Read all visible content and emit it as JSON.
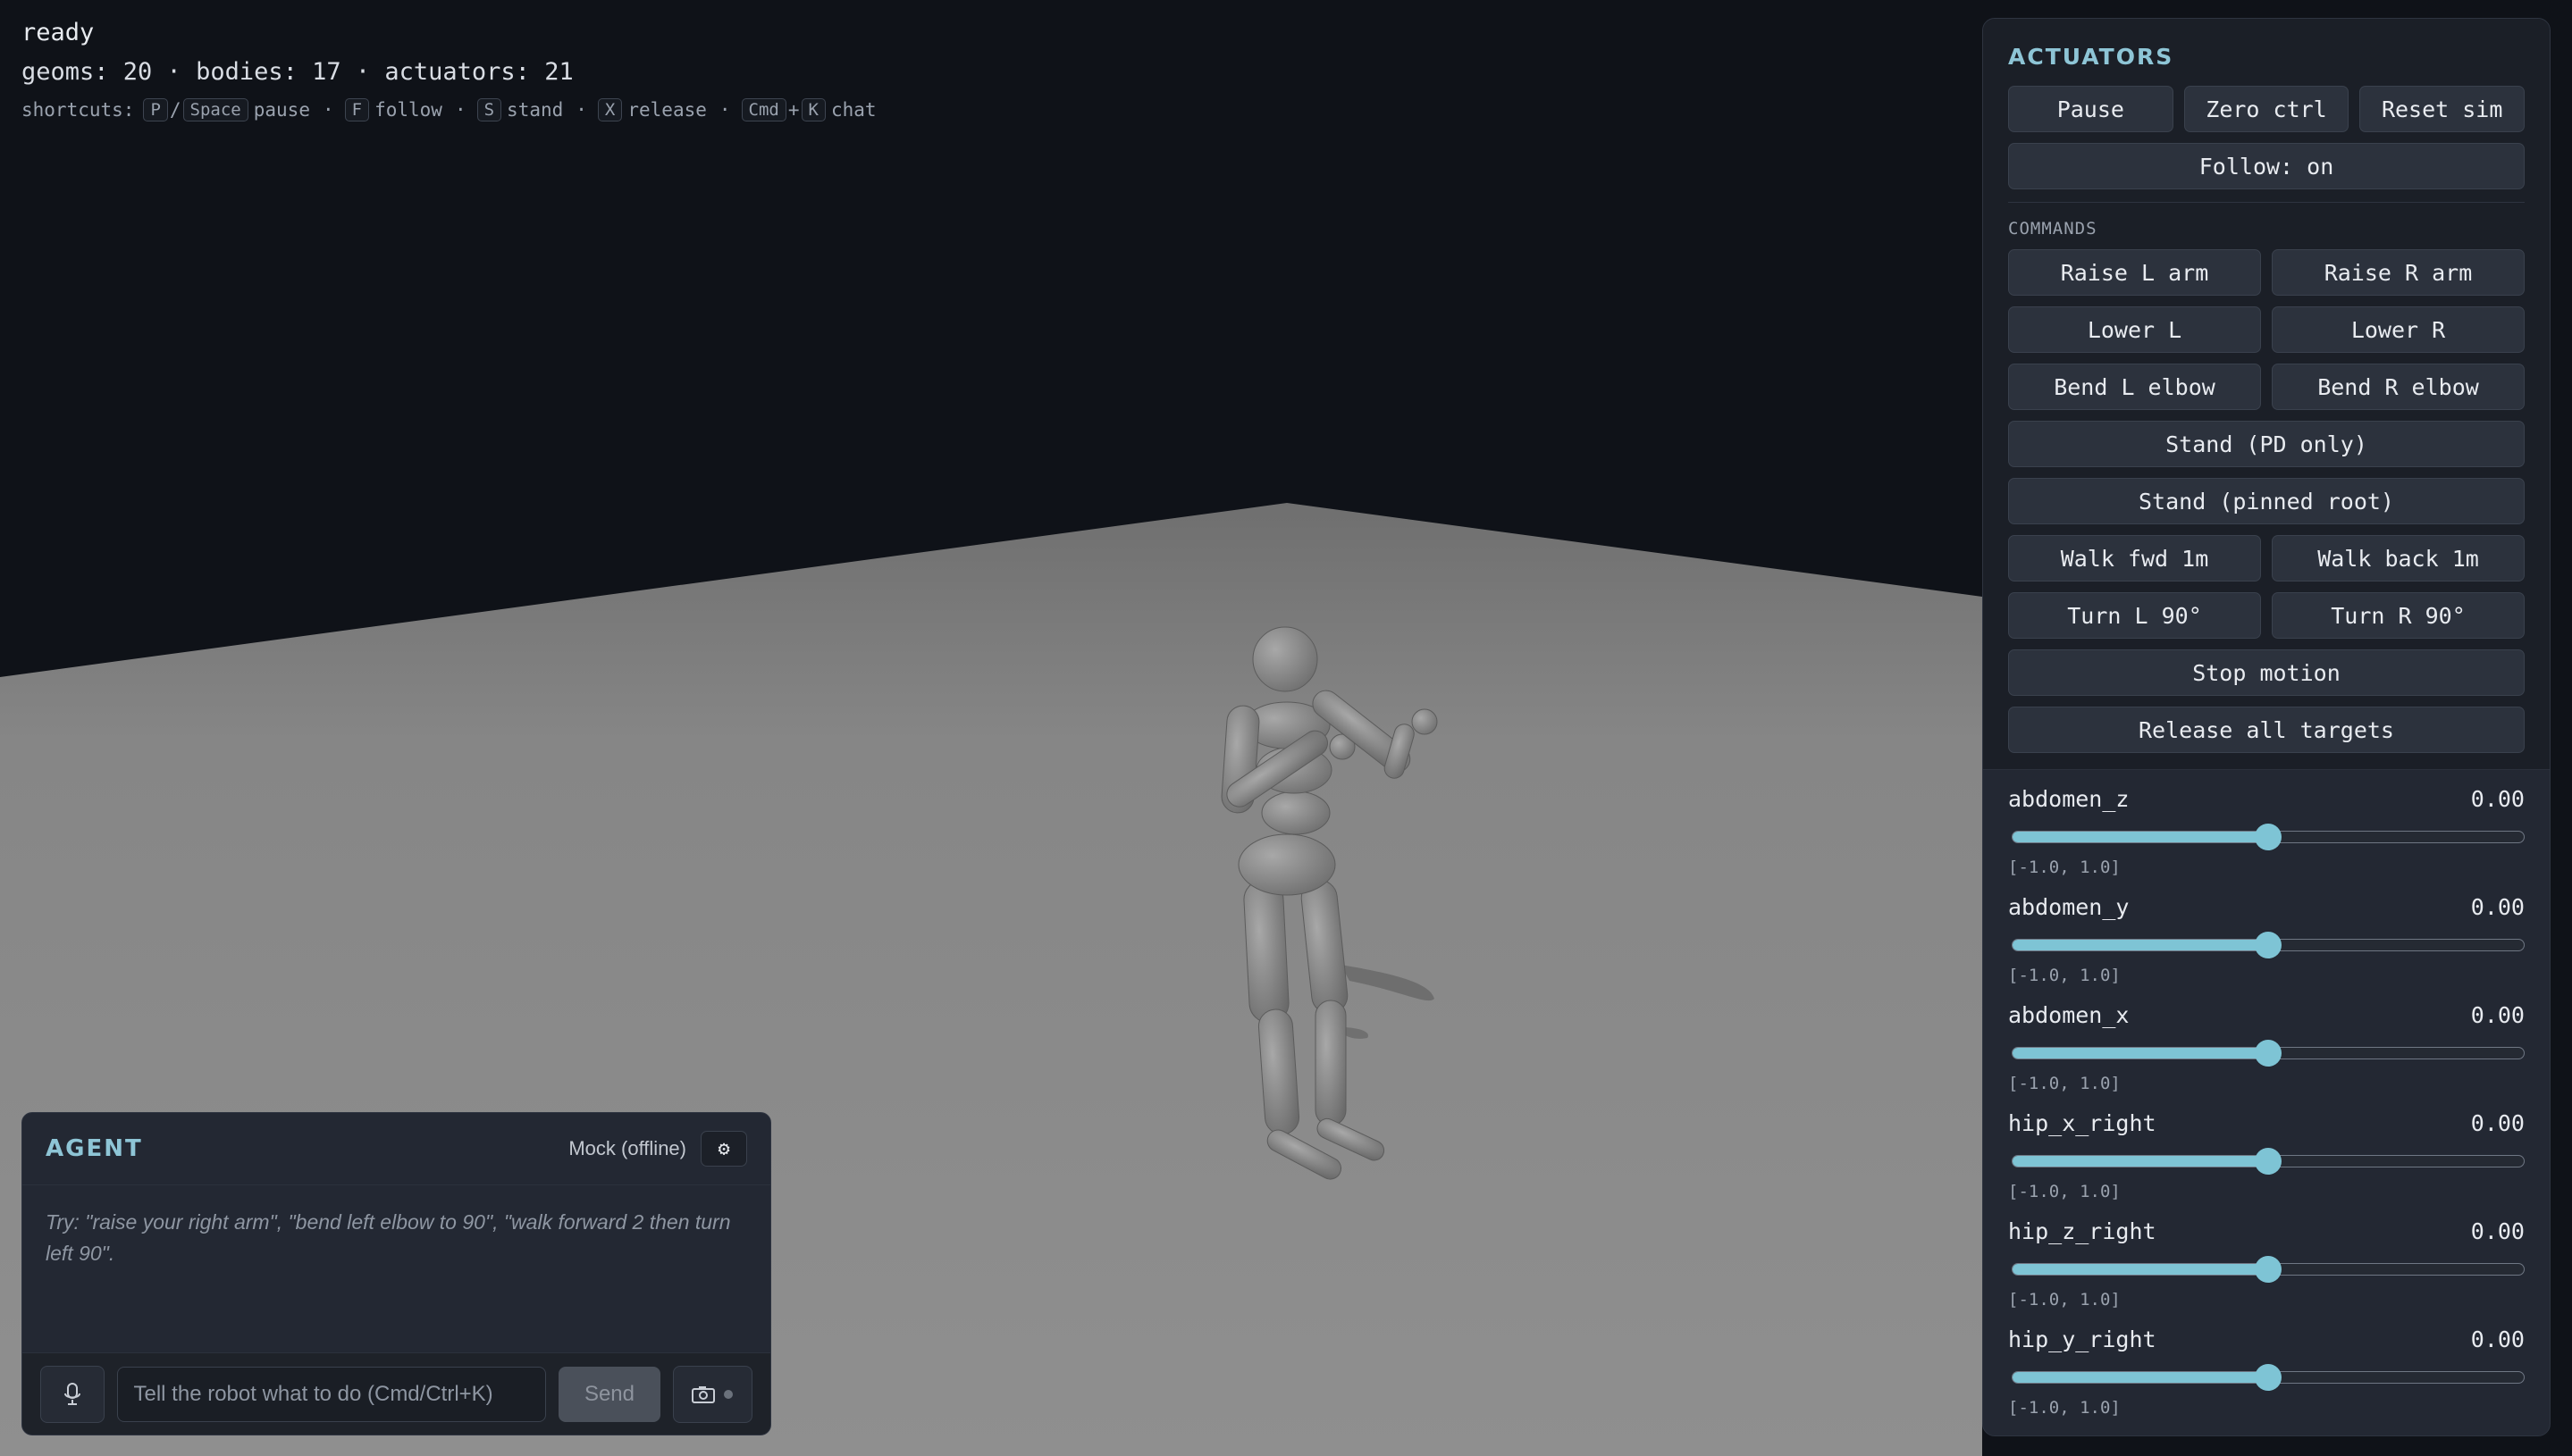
{
  "hud": {
    "status": "ready",
    "counts": "geoms: 20 · bodies: 17 · actuators: 21",
    "shortcuts_label": "shortcuts:",
    "shortcuts": [
      {
        "keys": [
          "P",
          "Space"
        ],
        "joiner": "/",
        "action": "pause"
      },
      {
        "keys": [
          "F"
        ],
        "action": "follow"
      },
      {
        "keys": [
          "S"
        ],
        "action": "stand"
      },
      {
        "keys": [
          "X"
        ],
        "action": "release"
      },
      {
        "keys": [
          "Cmd",
          "K"
        ],
        "joiner": "+",
        "action": "chat"
      }
    ],
    "separator": "·"
  },
  "actuators": {
    "title": "ACTUATORS",
    "pause": "Pause",
    "zero_ctrl": "Zero ctrl",
    "reset_sim": "Reset sim",
    "follow": "Follow: on",
    "commands_label": "COMMANDS",
    "commands": {
      "raise_l_arm": "Raise L arm",
      "raise_r_arm": "Raise R arm",
      "lower_l": "Lower L",
      "lower_r": "Lower R",
      "bend_l_elbow": "Bend L elbow",
      "bend_r_elbow": "Bend R elbow",
      "stand_pd": "Stand (PD only)",
      "stand_pinned": "Stand (pinned root)",
      "walk_fwd": "Walk fwd 1m",
      "walk_back": "Walk back 1m",
      "turn_l": "Turn L 90°",
      "turn_r": "Turn R 90°",
      "stop_motion": "Stop motion",
      "release_all": "Release all targets"
    },
    "sliders": [
      {
        "name": "abdomen_z",
        "value": "0.00",
        "range": "[-1.0, 1.0]",
        "fraction": 0.5
      },
      {
        "name": "abdomen_y",
        "value": "0.00",
        "range": "[-1.0, 1.0]",
        "fraction": 0.5
      },
      {
        "name": "abdomen_x",
        "value": "0.00",
        "range": "[-1.0, 1.0]",
        "fraction": 0.5
      },
      {
        "name": "hip_x_right",
        "value": "0.00",
        "range": "[-1.0, 1.0]",
        "fraction": 0.5
      },
      {
        "name": "hip_z_right",
        "value": "0.00",
        "range": "[-1.0, 1.0]",
        "fraction": 0.5
      },
      {
        "name": "hip_y_right",
        "value": "0.00",
        "range": "[-1.0, 1.0]",
        "fraction": 0.5
      }
    ]
  },
  "agent": {
    "title": "AGENT",
    "mode": "Mock (offline)",
    "gear_icon": "gear-icon",
    "hint": "Try: \"raise your right arm\", \"bend left elbow to 90\", \"walk forward 2 then turn left 90\".",
    "input_placeholder": "Tell the robot what to do (Cmd/Ctrl+K)",
    "send": "Send",
    "mic_icon": "microphone-icon",
    "camera_icon": "camera-icon"
  },
  "colors": {
    "accent": "#7ec4d5",
    "title": "#8ec5d6",
    "sky": "#0f1218",
    "floor": "#8a8a8a"
  }
}
